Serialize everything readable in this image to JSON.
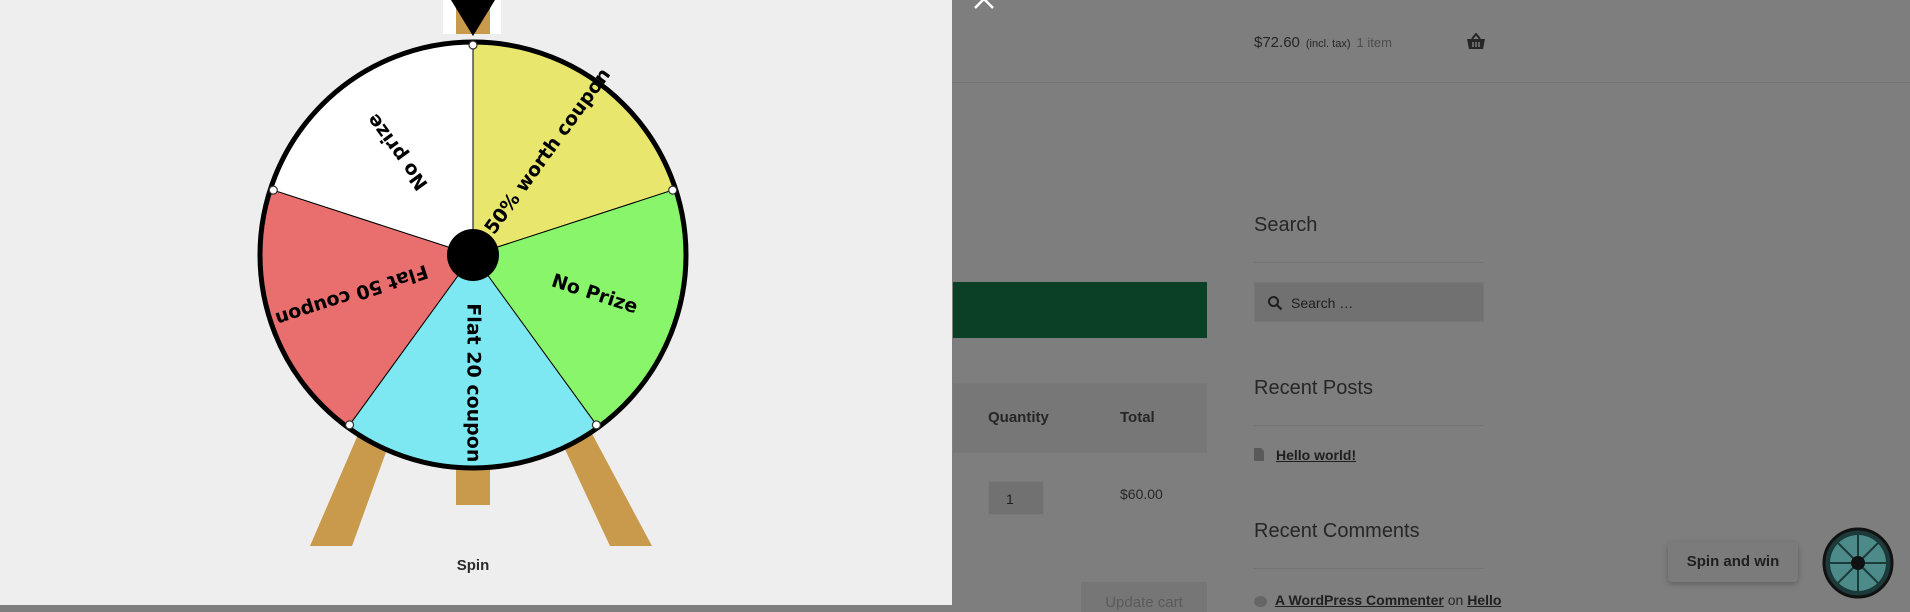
{
  "header": {
    "cart_total": "$72.60",
    "cart_tax_note": "(incl. tax)",
    "cart_count": "1 item"
  },
  "sidebar": {
    "search_title": "Search",
    "search_placeholder": "Search …",
    "recent_posts_title": "Recent Posts",
    "recent_post": "Hello world!",
    "recent_comments_title": "Recent Comments",
    "comment_author": "A WordPress Commenter",
    "comment_on": "on",
    "comment_post": "Hello"
  },
  "cart_table": {
    "col_quantity": "Quantity",
    "col_total": "Total",
    "quantity_value": "1",
    "line_total": "$60.00",
    "update_button": "Update cart"
  },
  "wheel": {
    "segments": [
      {
        "label": "50% worth coupon",
        "color": "#e9e66e"
      },
      {
        "label": "No Prize",
        "color": "#88f56b"
      },
      {
        "label": "Flat 20 coupon",
        "color": "#7de8f2"
      },
      {
        "label": "Flat 50 coupon",
        "color": "#e96e6e"
      },
      {
        "label": "No prize",
        "color": "#ffffff"
      }
    ],
    "spin_label": "Spin",
    "stand_color": "#c9994c"
  },
  "floating": {
    "spin_and_win_label": "Spin and win"
  },
  "icons": [
    "close-icon",
    "basket-icon",
    "search-icon",
    "post-icon",
    "comment-icon",
    "wheel-pointer-icon",
    "mini-wheel-icon"
  ]
}
